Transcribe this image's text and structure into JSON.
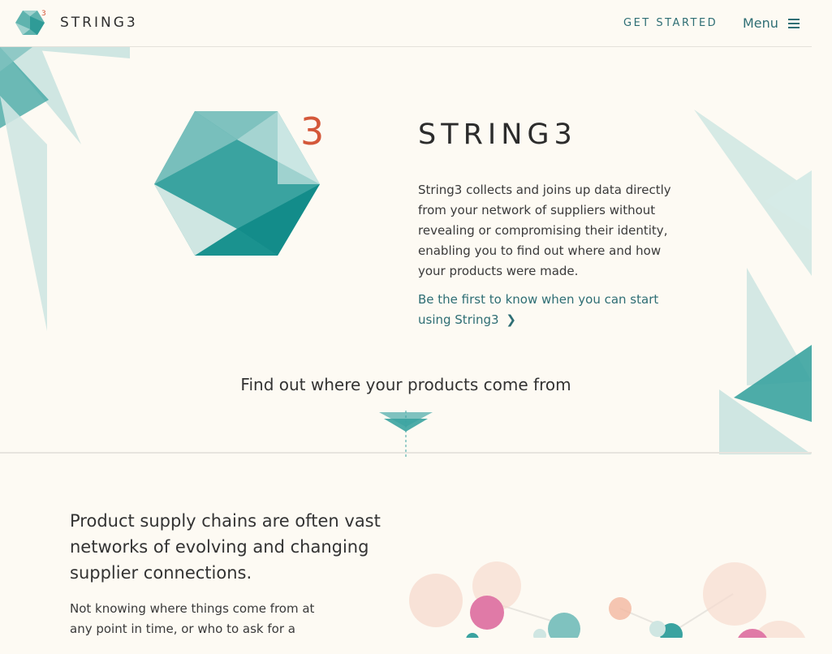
{
  "header": {
    "brand": "STRING3",
    "logo_superscript": "3",
    "get_started": "GET STARTED",
    "menu_label": "Menu"
  },
  "hero": {
    "logo_superscript": "3",
    "title": "STRING3",
    "description": "String3 collects and joins up data directly from your network of suppliers without revealing or compromising their identity, enabling you to find out where and how your products were made.",
    "cta": "Be the first to know when you can start using String3"
  },
  "tagline": "Find out where your products come from",
  "section2": {
    "lead": "Product supply chains are often vast networks of evolving and changing supplier connections.",
    "body": "Not knowing where things come from at any point in time, or who to ask for a"
  },
  "colors": {
    "background": "#fdfaf3",
    "teal_dark": "#138c8a",
    "teal": "#3aa3a0",
    "teal_light": "#7fc2bf",
    "teal_pale": "#cfe6e2",
    "accent_orange": "#d4583a",
    "link": "#2e6e74",
    "pink": "#e07aa7",
    "peach": "#f6dccf"
  },
  "icons": {
    "logo": "hexagon-logo-icon",
    "menu": "hamburger-menu-icon",
    "chevron": "chevron-right-icon",
    "tagline_mark": "down-triangle-icon"
  }
}
